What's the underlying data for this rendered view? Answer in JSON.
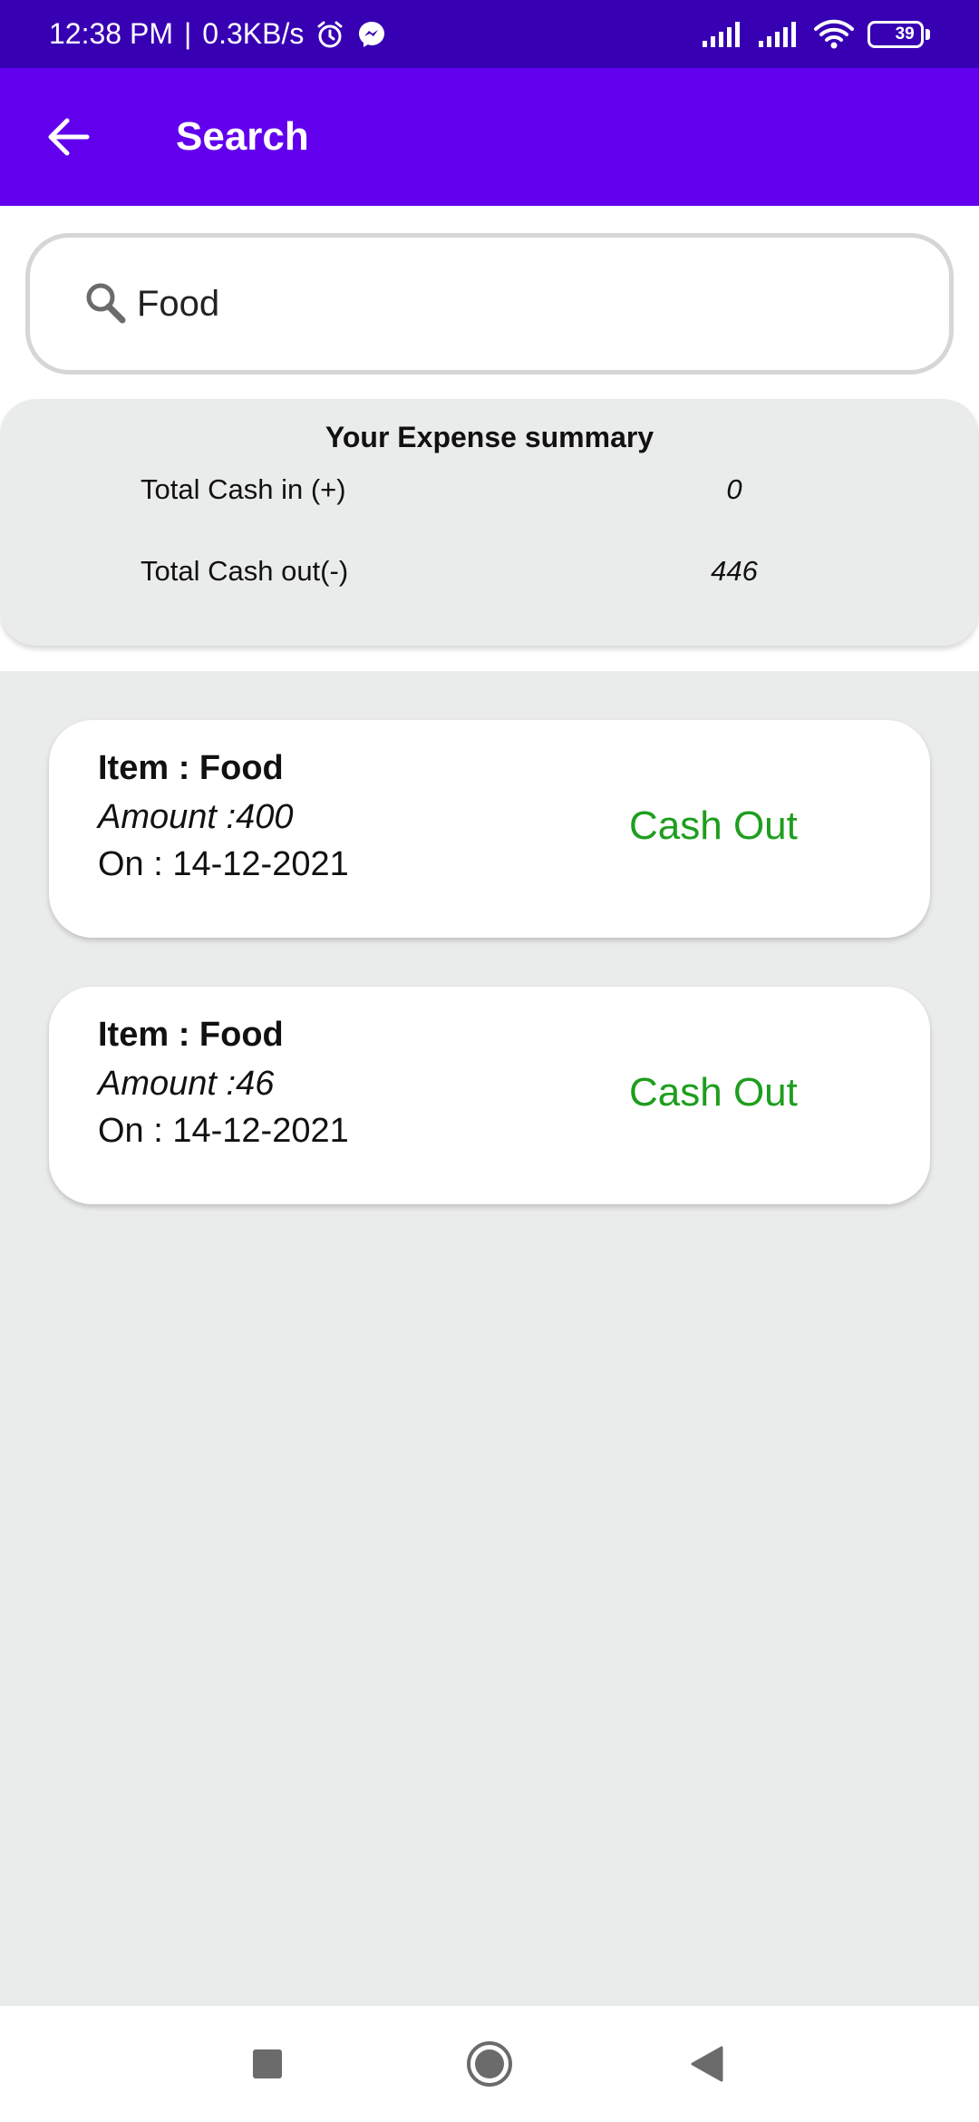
{
  "status_bar": {
    "time": "12:38 PM",
    "separator": "|",
    "speed": "0.3KB/s",
    "battery": "39",
    "battery_level": 0.39,
    "icons": [
      "alarm-icon",
      "messenger-icon",
      "signal-icon",
      "signal-icon",
      "wifi-icon",
      "battery-icon"
    ]
  },
  "app_bar": {
    "title": "Search",
    "back_icon": "arrow-left-icon"
  },
  "search": {
    "value": "Food",
    "icon": "search-icon"
  },
  "summary": {
    "title": "Your Expense summary",
    "cash_in_label": "Total Cash in (+)",
    "cash_in_value": "0",
    "cash_out_label": "Total Cash out(-)",
    "cash_out_value": "446"
  },
  "results": [
    {
      "item": "Item : Food",
      "amount": "Amount :400",
      "date": "On : 14-12-2021",
      "type": "Cash Out"
    },
    {
      "item": "Item : Food",
      "amount": "Amount :46",
      "date": "On : 14-12-2021",
      "type": "Cash Out"
    }
  ],
  "colors": {
    "status_bar": "#3700b3",
    "app_bar": "#6200ee",
    "cash_out": "#1e9e1e",
    "background": "#eaebeb"
  },
  "nav_bar": {
    "icons": [
      "recents-icon",
      "home-icon",
      "back-icon"
    ]
  }
}
